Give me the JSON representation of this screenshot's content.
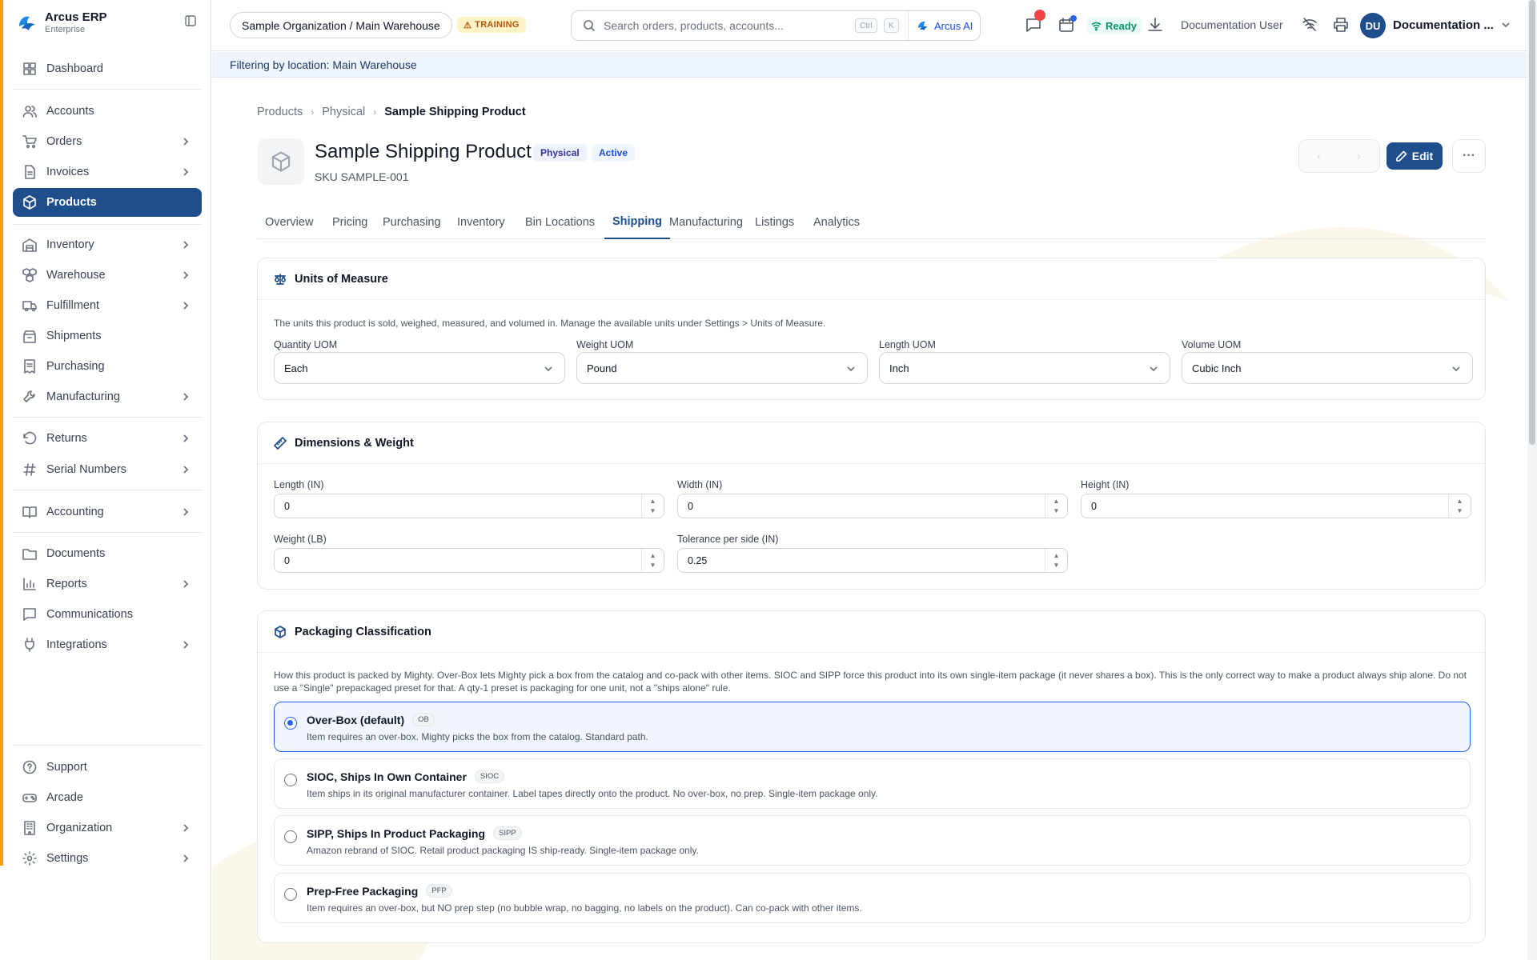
{
  "app": {
    "name": "Arcus ERP",
    "edition": "Enterprise"
  },
  "sidebar": {
    "items": [
      {
        "label": "Dashboard",
        "icon": "dashboard-icon"
      },
      {
        "label": "Accounts",
        "icon": "users-icon"
      },
      {
        "label": "Orders",
        "icon": "cart-icon"
      },
      {
        "label": "Invoices",
        "icon": "invoice-icon"
      },
      {
        "label": "Products",
        "icon": "box-icon",
        "active": true
      },
      {
        "label": "Inventory",
        "icon": "warehouse-icon"
      },
      {
        "label": "Warehouse",
        "icon": "boxes-icon"
      },
      {
        "label": "Fulfillment",
        "icon": "truck-icon"
      },
      {
        "label": "Shipments",
        "icon": "package-icon"
      },
      {
        "label": "Purchasing",
        "icon": "receipt-icon"
      },
      {
        "label": "Manufacturing",
        "icon": "wrench-icon"
      },
      {
        "label": "Returns",
        "icon": "return-icon"
      },
      {
        "label": "Serial Numbers",
        "icon": "hash-icon"
      },
      {
        "label": "Accounting",
        "icon": "book-icon"
      },
      {
        "label": "Documents",
        "icon": "folder-icon"
      },
      {
        "label": "Reports",
        "icon": "bar-chart-icon"
      },
      {
        "label": "Communications",
        "icon": "message-icon"
      },
      {
        "label": "Integrations",
        "icon": "plug-icon"
      },
      {
        "label": "Support",
        "icon": "help-icon"
      },
      {
        "label": "Arcade",
        "icon": "gamepad-icon"
      },
      {
        "label": "Organization",
        "icon": "building-icon"
      },
      {
        "label": "Settings",
        "icon": "gear-icon"
      }
    ]
  },
  "header": {
    "location": "Sample Organization / Main Warehouse",
    "training_badge": "TRAINING",
    "search_placeholder": "Search orders, products, accounts...",
    "kbd_ctrl": "Ctrl",
    "kbd_k": "K",
    "ai_label": "Arcus AI",
    "status": "Ready",
    "doc_user": "Documentation User",
    "avatar_initials": "DU",
    "user_name": "Documentation ..."
  },
  "filter_bar": {
    "text": "Filtering by location: Main Warehouse"
  },
  "breadcrumb": {
    "items": [
      "Products",
      "Physical"
    ],
    "current": "Sample Shipping Product"
  },
  "product": {
    "title": "Sample Shipping Product",
    "type_badge": "Physical",
    "status_badge": "Active",
    "sku": "SKU SAMPLE-001",
    "edit_label": "Edit",
    "more_label": "···"
  },
  "tabs": [
    "Overview",
    "Pricing",
    "Purchasing",
    "Inventory",
    "Bin Locations",
    "Shipping",
    "Manufacturing",
    "Listings",
    "Analytics"
  ],
  "active_tab": "Shipping",
  "uom": {
    "title": "Units of Measure",
    "description": "The units this product is sold, weighed, measured, and volumed in. Manage the available units under Settings > Units of Measure.",
    "fields": [
      {
        "label": "Quantity UOM",
        "value": "Each"
      },
      {
        "label": "Weight UOM",
        "value": "Pound"
      },
      {
        "label": "Length UOM",
        "value": "Inch"
      },
      {
        "label": "Volume UOM",
        "value": "Cubic Inch"
      }
    ]
  },
  "dimensions": {
    "title": "Dimensions & Weight",
    "fields": [
      {
        "label": "Length (IN)",
        "value": "0"
      },
      {
        "label": "Width (IN)",
        "value": "0"
      },
      {
        "label": "Height (IN)",
        "value": "0"
      },
      {
        "label": "Weight (LB)",
        "value": "0"
      },
      {
        "label": "Tolerance per side (IN)",
        "value": "0.25"
      }
    ]
  },
  "packaging": {
    "title": "Packaging Classification",
    "description_1": "How this product is packed by Mighty. Over-Box lets Mighty pick a box from the catalog and co-pack with other items. SIOC and SIPP force this product into its own single-item package (it never shares a box). This is the only correct way to make a product always ship alone. Do not",
    "description_2": "use a \"Single\" prepackaged preset for that. A qty-1 preset is packaging for one unit, not a \"ships alone\" rule.",
    "options": [
      {
        "title": "Over-Box (default)",
        "code": "OB",
        "description": "Item requires an over-box. Mighty picks the box from the catalog. Standard path.",
        "selected": true
      },
      {
        "title": "SIOC, Ships In Own Container",
        "code": "SIOC",
        "description": "Item ships in its original manufacturer container. Label tapes directly onto the product. No over-box, no prep. Single-item package only.",
        "selected": false
      },
      {
        "title": "SIPP, Ships In Product Packaging",
        "code": "SIPP",
        "description": "Amazon rebrand of SIOC. Retail product packaging IS ship-ready. Single-item package only.",
        "selected": false
      },
      {
        "title": "Prep-Free Packaging",
        "code": "PFP",
        "description": "Item requires an over-box, but NO prep step (no bubble wrap, no bagging, no labels on the product). Can co-pack with other items.",
        "selected": false
      }
    ]
  },
  "colors": {
    "primary": "#1e4e8c",
    "accent": "#2563eb",
    "sidebar_strip": "#f59e0b",
    "ready": "#059669",
    "training": "#b45309"
  }
}
